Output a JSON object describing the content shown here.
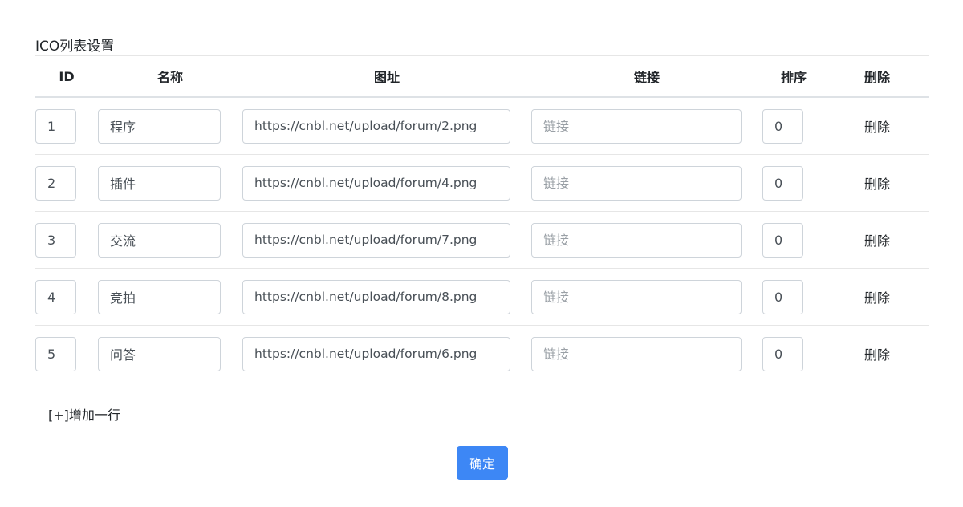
{
  "section": {
    "title": "ICO列表设置"
  },
  "table": {
    "headers": {
      "id": "ID",
      "name": "名称",
      "url": "图址",
      "link": "链接",
      "sort": "排序",
      "delete": "删除"
    },
    "link_placeholder": "链接",
    "delete_label": "删除",
    "rows": [
      {
        "id": "1",
        "name": "程序",
        "url": "https://cnbl.net/upload/forum/2.png",
        "link": "",
        "sort": "0"
      },
      {
        "id": "2",
        "name": "插件",
        "url": "https://cnbl.net/upload/forum/4.png",
        "link": "",
        "sort": "0"
      },
      {
        "id": "3",
        "name": "交流",
        "url": "https://cnbl.net/upload/forum/7.png",
        "link": "",
        "sort": "0"
      },
      {
        "id": "4",
        "name": "竞拍",
        "url": "https://cnbl.net/upload/forum/8.png",
        "link": "",
        "sort": "0"
      },
      {
        "id": "5",
        "name": "问答",
        "url": "https://cnbl.net/upload/forum/6.png",
        "link": "",
        "sort": "0"
      }
    ]
  },
  "actions": {
    "add_row_label": "[+]增加一行",
    "confirm_label": "确定"
  },
  "colors": {
    "primary": "#3d87f5",
    "border": "#ced4da",
    "divider": "#e6e6e6",
    "text": "#212529"
  }
}
